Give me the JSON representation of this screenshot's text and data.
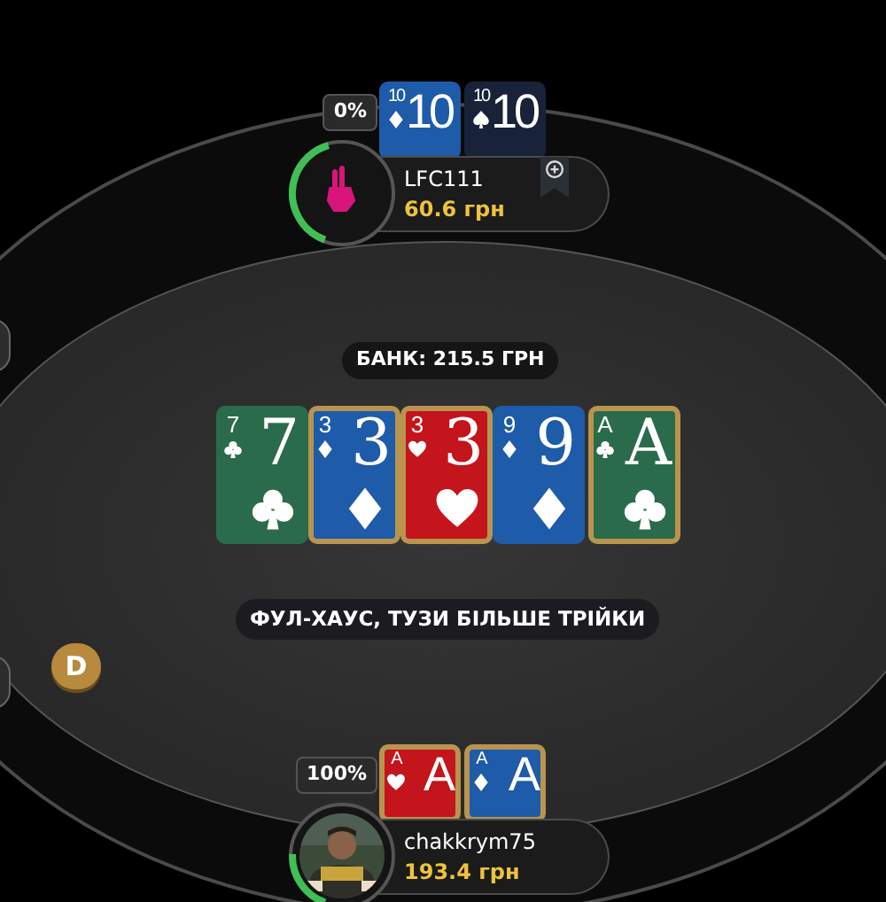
{
  "pot": "БАНК: 215.5 ГРН",
  "board": [
    {
      "corner_rank": "7",
      "rank": "7",
      "suit": {
        "kind": "clubs"
      },
      "highlighted": false
    },
    {
      "corner_rank": "3",
      "rank": "3",
      "suit": {
        "kind": "diamonds"
      },
      "highlighted": true
    },
    {
      "corner_rank": "3",
      "rank": "3",
      "suit": {
        "kind": "hearts"
      },
      "highlighted": true
    },
    {
      "corner_rank": "9",
      "rank": "9",
      "suit": {
        "kind": "diamonds"
      },
      "highlighted": false
    },
    {
      "corner_rank": "A",
      "rank": "A",
      "suit": {
        "kind": "clubs"
      },
      "highlighted": true
    }
  ],
  "hand_result": "ФУЛ-ХАУС, ТУЗИ БІЛЬШЕ ТРІЙКИ",
  "dealer_button": "D",
  "players": [
    {
      "equity": "0%",
      "name": "LFC111",
      "chips": "60.6 грн",
      "timer": {
        "level": 0.4
      },
      "avatar": {
        "kind": "logo"
      },
      "add_button": true,
      "cards": [
        {
          "corner_rank": "10",
          "rank": "10",
          "suit": {
            "kind": "diamonds"
          },
          "highlighted": false
        },
        {
          "corner_rank": "10",
          "rank": "10",
          "suit": {
            "kind": "spades"
          },
          "highlighted": false
        }
      ]
    },
    {
      "equity": "100%",
      "name": "chakkrym75",
      "chips": "193.4 грн",
      "timer": {
        "level": 0.2
      },
      "add_button": false,
      "cards": [
        {
          "corner_rank": "A",
          "rank": "A",
          "suit": {
            "kind": "hearts"
          },
          "highlighted": true
        },
        {
          "corner_rank": "A",
          "rank": "A",
          "suit": {
            "kind": "diamonds"
          },
          "highlighted": true
        }
      ]
    }
  ]
}
